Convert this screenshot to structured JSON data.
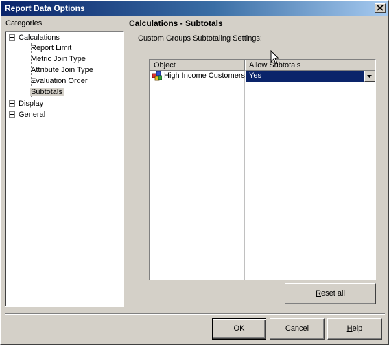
{
  "window": {
    "title": "Report Data Options"
  },
  "categories": {
    "label": "Categories",
    "tree": {
      "calculations": "Calculations",
      "calc_children": [
        "Report Limit",
        "Metric Join Type",
        "Attribute Join Type",
        "Evaluation Order",
        "Subtotals"
      ],
      "display": "Display",
      "general": "General"
    }
  },
  "panel": {
    "heading": "Calculations - Subtotals",
    "subheading": "Custom Groups Subtotaling Settings:"
  },
  "grid": {
    "columns": [
      "Object",
      "Allow Subtotals"
    ],
    "rows": [
      {
        "object": "High Income Customers",
        "allow": "Yes"
      }
    ]
  },
  "buttons": {
    "reset_all": "Reset all",
    "reset_all_accel": "R",
    "reset_all_rest": "eset all",
    "ok": "OK",
    "cancel": "Cancel",
    "help_accel": "H",
    "help_rest": "elp"
  }
}
